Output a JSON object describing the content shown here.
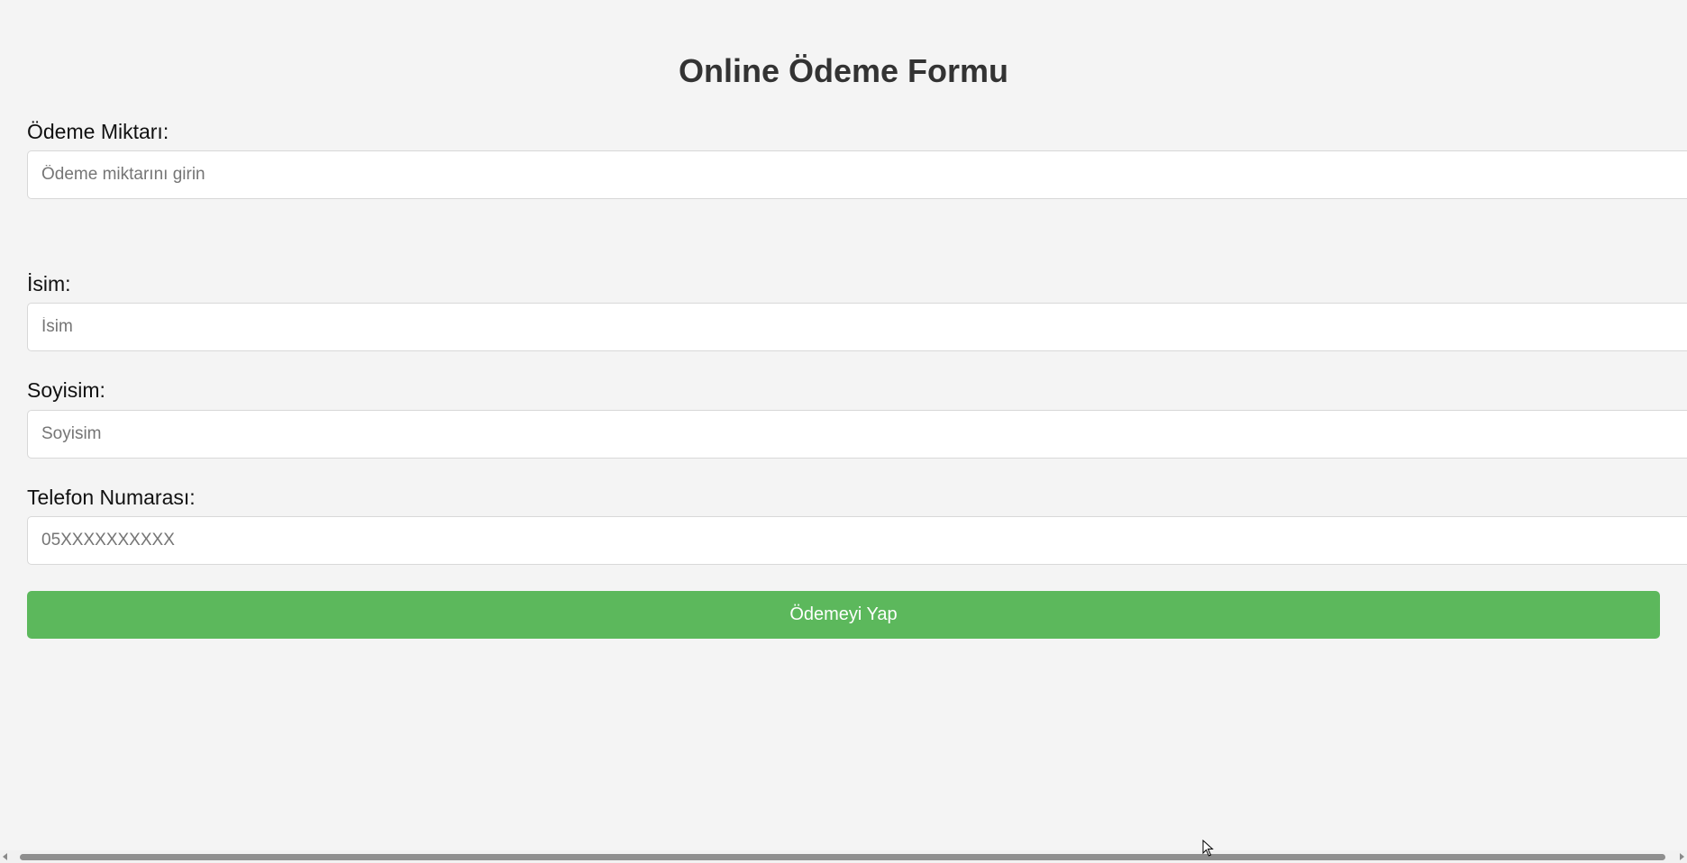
{
  "form": {
    "title": "Online Ödeme Formu",
    "amount": {
      "label": "Ödeme Miktarı:",
      "placeholder": "Ödeme miktarını girin"
    },
    "first_name": {
      "label": "İsim:",
      "placeholder": "İsim"
    },
    "last_name": {
      "label": "Soyisim:",
      "placeholder": "Soyisim"
    },
    "phone": {
      "label": "Telefon Numarası:",
      "placeholder": "05XXXXXXXXXX"
    },
    "submit_label": "Ödemeyi Yap"
  },
  "colors": {
    "background": "#f4f4f4",
    "button": "#5cb85c",
    "title": "#333333"
  },
  "icons": {
    "cursor": "mouse-pointer-icon",
    "scroll_left": "scroll-left-arrow-icon",
    "scroll_right": "scroll-right-arrow-icon"
  }
}
